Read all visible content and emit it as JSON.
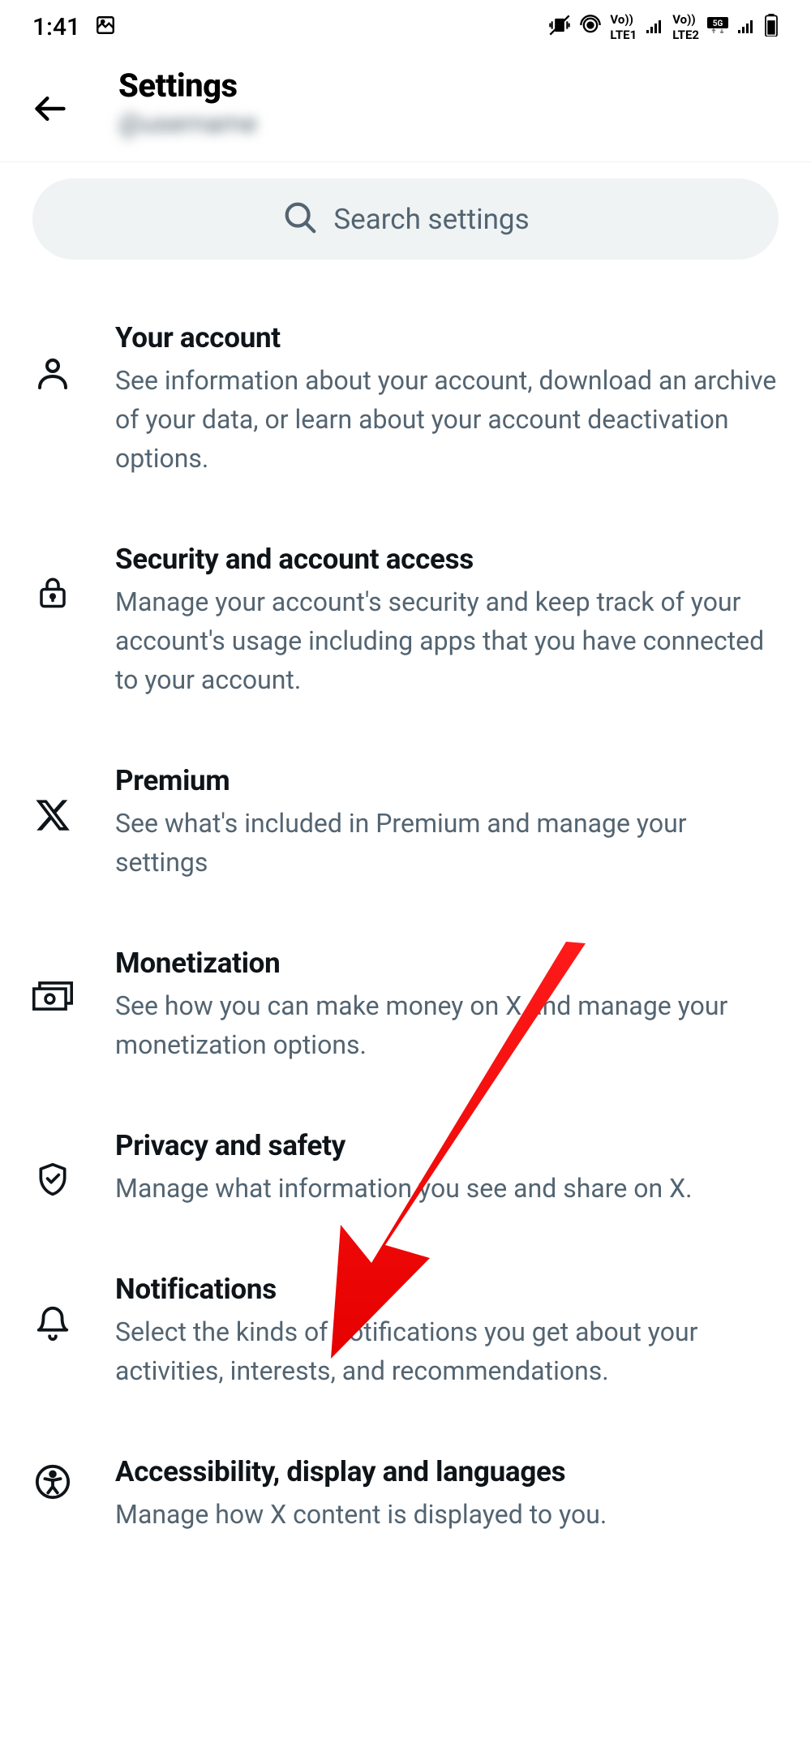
{
  "status": {
    "time": "1:41"
  },
  "header": {
    "title": "Settings",
    "subtitle": "@username"
  },
  "search": {
    "placeholder": "Search settings"
  },
  "settings": [
    {
      "title": "Your account",
      "desc": "See information about your account, download an archive of your data, or learn about your account deactivation options."
    },
    {
      "title": "Security and account access",
      "desc": "Manage your account's security and keep track of your account's usage including apps that you have connected to your account."
    },
    {
      "title": "Premium",
      "desc": "See what's included in Premium and manage your settings"
    },
    {
      "title": "Monetization",
      "desc": "See how you can make money on X and manage your monetization options."
    },
    {
      "title": "Privacy and safety",
      "desc": "Manage what information you see and share on X."
    },
    {
      "title": "Notifications",
      "desc": "Select the kinds of notifications you get about your activities, interests, and recommendations."
    },
    {
      "title": "Accessibility, display and languages",
      "desc": "Manage how X content is displayed to you."
    }
  ]
}
